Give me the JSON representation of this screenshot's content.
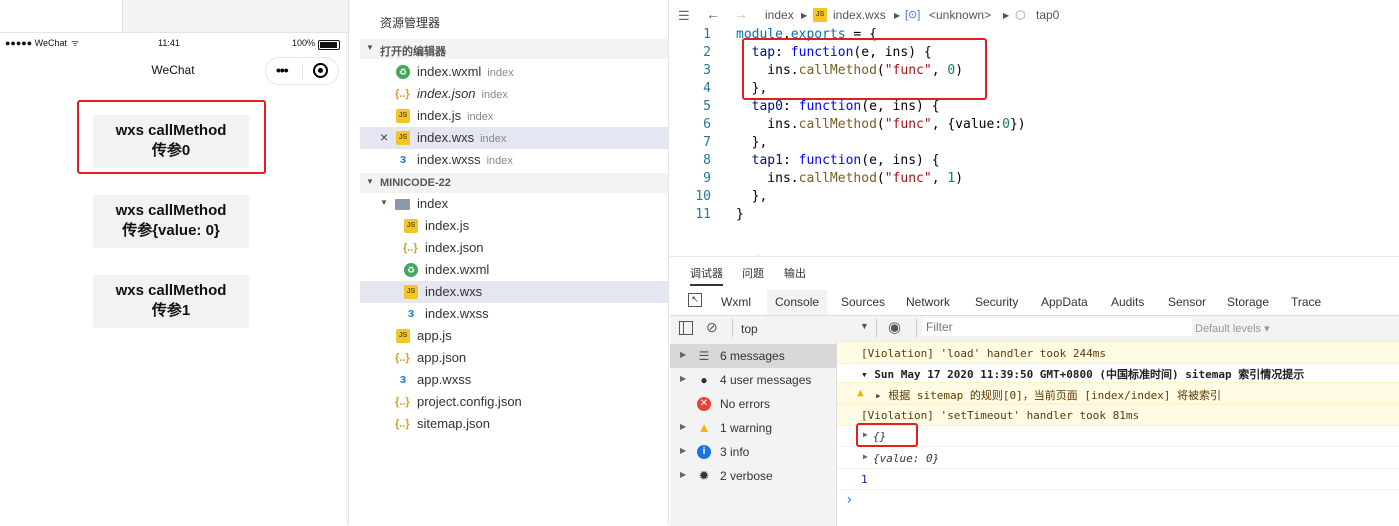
{
  "simulator": {
    "status_carrier": "●●●●● WeChat",
    "status_time": "11:41",
    "status_battery": "100%",
    "nav_title": "WeChat",
    "buttons": [
      {
        "line1": "wxs callMethod",
        "line2": "传参0"
      },
      {
        "line1": "wxs callMethod",
        "line2": "传参{value: 0}"
      },
      {
        "line1": "wxs callMethod",
        "line2": "传参1"
      }
    ]
  },
  "explorer": {
    "title": "资源管理器",
    "open_editors_label": "打开的编辑器",
    "open_editors": [
      {
        "name": "index.wxml",
        "hint": "index",
        "type": "wxml"
      },
      {
        "name": "index.json",
        "hint": "index",
        "type": "json"
      },
      {
        "name": "index.js",
        "hint": "index",
        "type": "js"
      },
      {
        "name": "index.wxs",
        "hint": "index",
        "type": "js"
      },
      {
        "name": "index.wxss",
        "hint": "index",
        "type": "wxss"
      }
    ],
    "project_label": "MINICODE-22",
    "folder": "index",
    "folder_files": [
      "index.js",
      "index.json",
      "index.wxml",
      "index.wxs",
      "index.wxss"
    ],
    "root_files": [
      "app.js",
      "app.json",
      "app.wxss",
      "project.config.json",
      "sitemap.json"
    ]
  },
  "editor": {
    "breadcrumb": [
      "index",
      "index.wxs",
      "<unknown>",
      "tap0"
    ],
    "line_numbers": [
      "1",
      "2",
      "3",
      "4",
      "5",
      "6",
      "7",
      "8",
      "9",
      "10",
      "11"
    ]
  },
  "devtools": {
    "top_tabs": [
      "调试器",
      "问题",
      "输出"
    ],
    "panel_tabs": [
      "Wxml",
      "Console",
      "Sources",
      "Network",
      "Security",
      "AppData",
      "Audits",
      "Sensor",
      "Storage",
      "Trace"
    ],
    "context": "top",
    "filter_placeholder": "Filter",
    "levels": "Default levels ▾",
    "sidebar": [
      {
        "label": "6 messages",
        "icon": "list-icon"
      },
      {
        "label": "4 user messages",
        "icon": "user-icon"
      },
      {
        "label": "No errors",
        "icon": "error-icon"
      },
      {
        "label": "1 warning",
        "icon": "warning-icon"
      },
      {
        "label": "3 info",
        "icon": "info-icon"
      },
      {
        "label": "2 verbose",
        "icon": "verbose-icon"
      }
    ],
    "console": {
      "line1": "[Violation] 'load' handler took 244ms",
      "line2": "▾ Sun May 17 2020 11:39:50 GMT+0800 (中国标准时间) sitemap 索引情况提示",
      "line3": "▸ 根据 sitemap 的规则[0]，当前页面 [index/index] 将被索引",
      "line4": "[Violation] 'setTimeout' handler took 81ms",
      "line5": "{}",
      "line6": "{value: 0}",
      "line7": "1",
      "prompt": "›"
    }
  }
}
